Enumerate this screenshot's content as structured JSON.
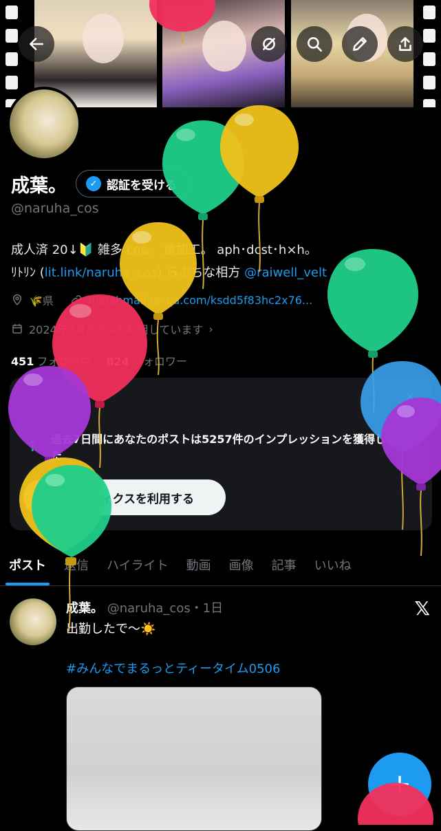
{
  "header": {
    "back_icon": "arrow-left-icon",
    "buttons": [
      "sync-off-icon",
      "search-icon",
      "edit-pencil-icon",
      "share-upload-icon"
    ]
  },
  "profile": {
    "name": "成葉。",
    "verify_label": "認証を受ける",
    "handle": "@naruha_cos",
    "bio_line1": "成人済 20↓🔰 雑多 cos。 重加工。 aph･dcst･h×h。",
    "bio_line2_prefix": "ﾘﾄﾘﾝ (",
    "bio_link": "lit.link/naruha_cos",
    "bio_line2_mid": ") らぶちな相方 ",
    "bio_mention": "@raiwell_velt",
    "location": "🌾県",
    "website": "marshmallow-qa.com/ksdd5f83hc2x76...",
    "joined": "2024年6月からXを利用しています",
    "following_count": "451",
    "following_label": "フォロー中",
    "followers_count": "824",
    "followers_label": "フォロワー"
  },
  "insight_card": {
    "private_label": "非公開",
    "message": "過去7日間にあなたのポストは5257件のインプレッションを獲得しました",
    "cta": "アナリティクスを利用する"
  },
  "tabs": [
    "ポスト",
    "返信",
    "ハイライト",
    "動画",
    "画像",
    "記事",
    "いいね"
  ],
  "post": {
    "author": "成葉。",
    "handle": "@naruha_cos",
    "time": "・1日",
    "text": "出勤したで〜☀️",
    "hashtag": "#みんなでまるっとティータイム0506"
  },
  "fab_label": "+",
  "colors": {
    "accent": "#1d9bf0",
    "balloon_green": "#1fcf8a",
    "balloon_yellow": "#f1c21b",
    "balloon_red": "#f2305c",
    "balloon_purple": "#a637d6",
    "balloon_blue": "#3aa0ee"
  }
}
